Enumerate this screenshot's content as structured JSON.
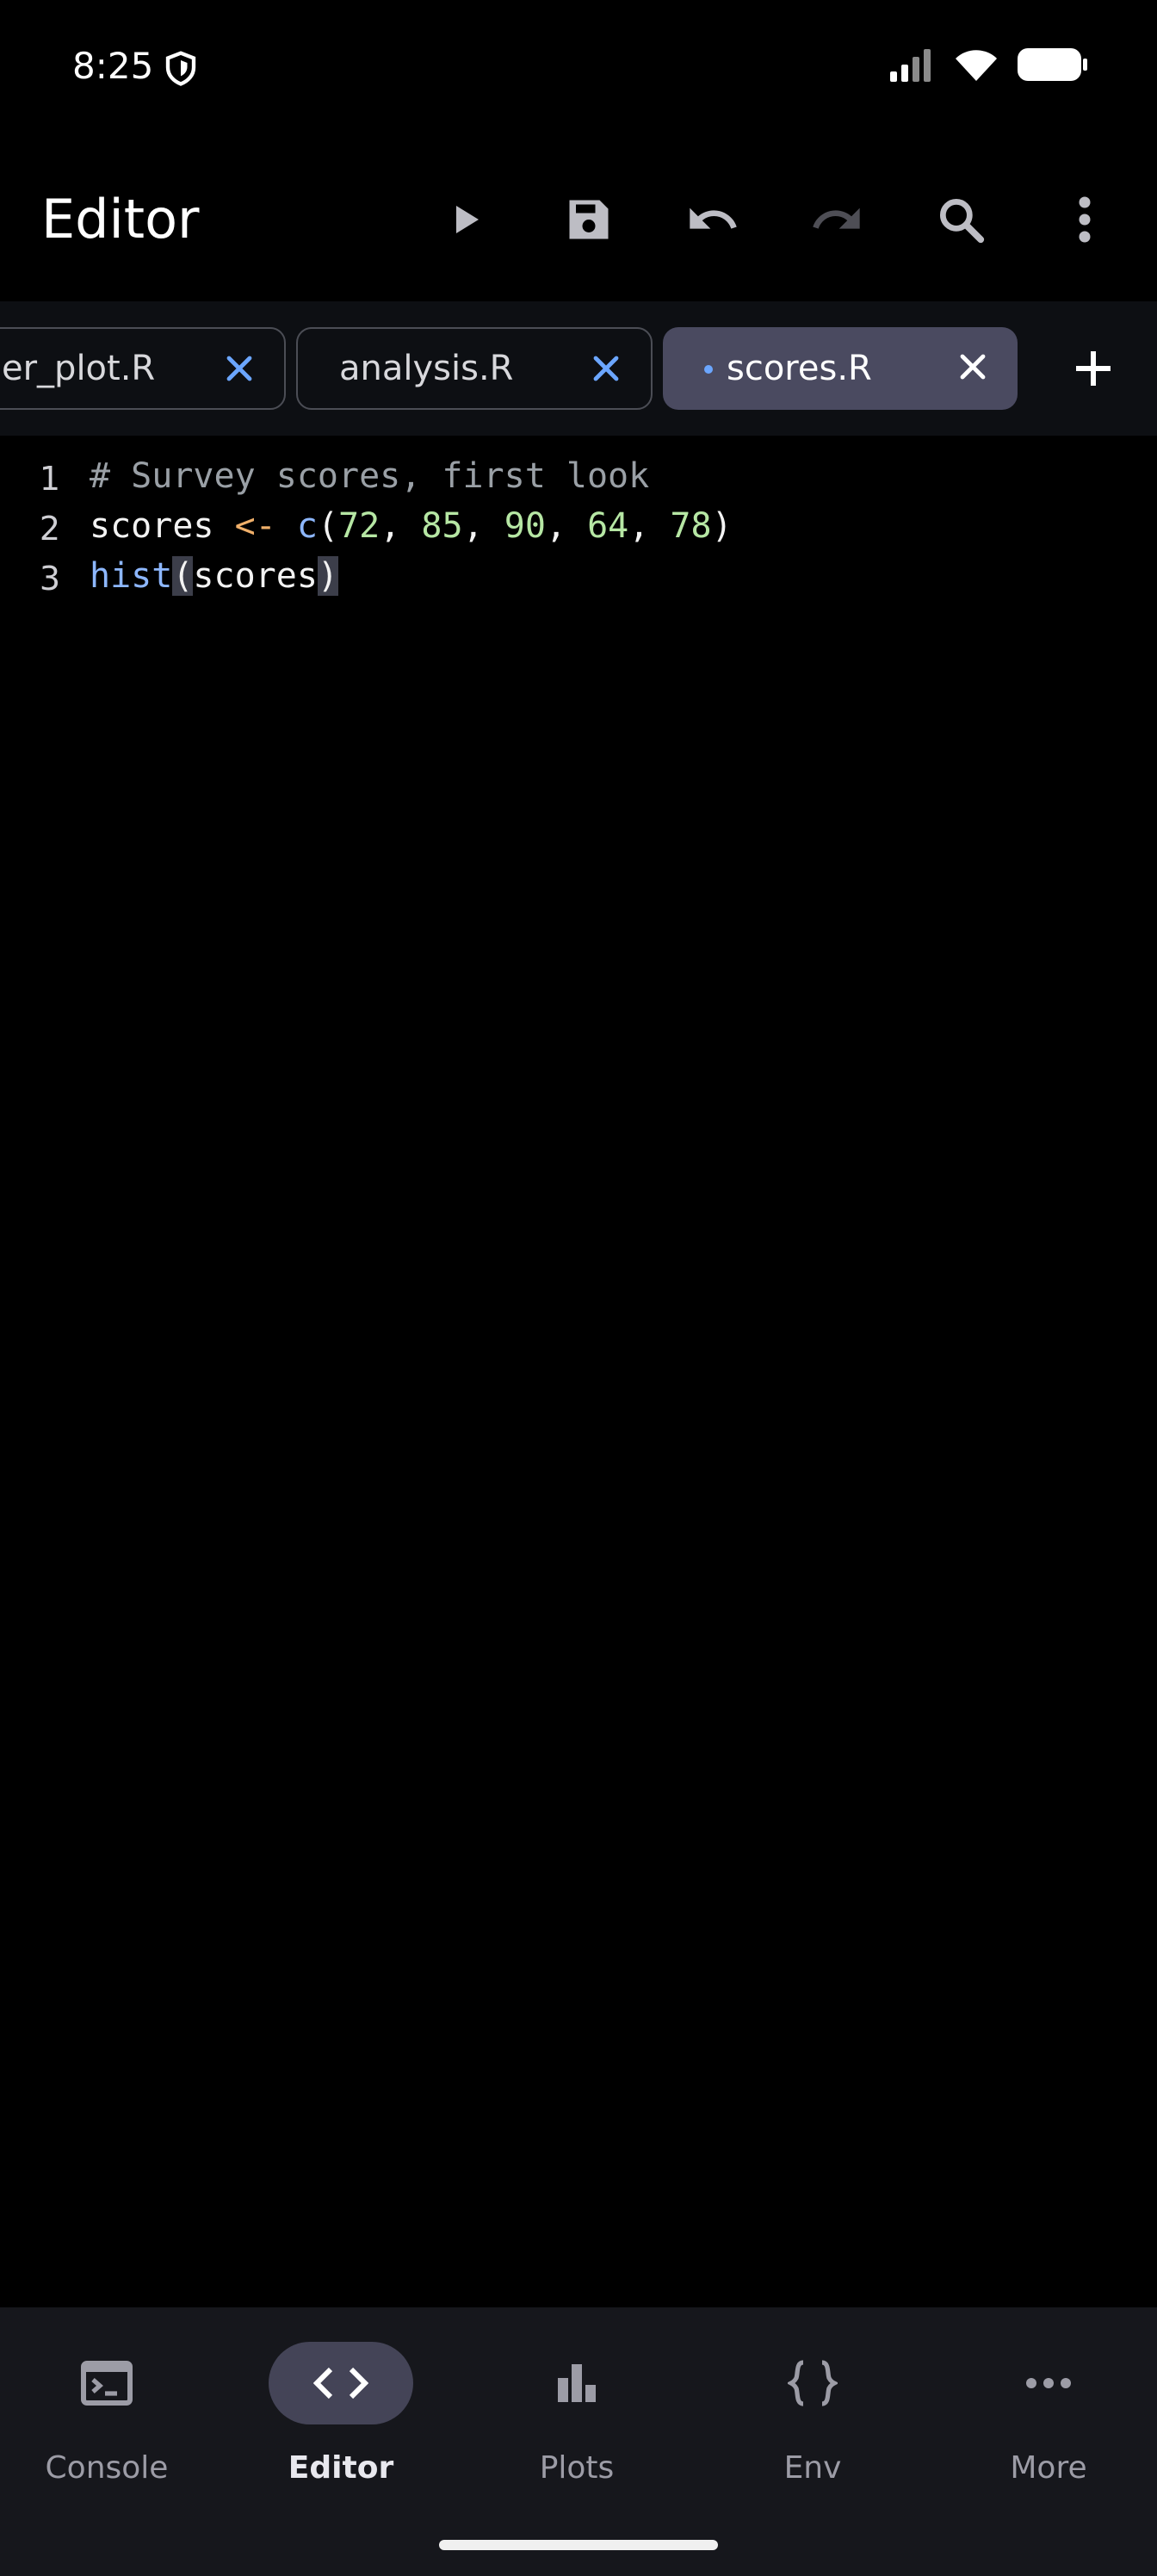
{
  "status": {
    "time": "8:25"
  },
  "appbar": {
    "title": "Editor",
    "actions": [
      {
        "name": "run",
        "icon": "play-icon"
      },
      {
        "name": "save",
        "icon": "save-icon"
      },
      {
        "name": "undo",
        "icon": "undo-icon"
      },
      {
        "name": "redo",
        "icon": "redo-icon"
      },
      {
        "name": "search",
        "icon": "search-icon"
      },
      {
        "name": "more",
        "icon": "more-vert-icon"
      }
    ]
  },
  "tabs": [
    {
      "label": "er_plot.R",
      "active": false
    },
    {
      "label": "analysis.R",
      "active": false
    },
    {
      "label": "scores.R",
      "active": true,
      "modified": true
    }
  ],
  "editor": {
    "lines": [
      {
        "number": "1",
        "comment": "# Survey scores, first look"
      },
      {
        "number": "2",
        "var": "scores",
        "op": "<-",
        "fn": "c",
        "nums": [
          "72",
          "85",
          "90",
          "64",
          "78"
        ]
      },
      {
        "number": "3",
        "fn": "hist",
        "arg": "scores"
      }
    ]
  },
  "nav": [
    {
      "label": "Console",
      "icon": "console-icon",
      "active": false
    },
    {
      "label": "Editor",
      "icon": "code-icon",
      "active": true
    },
    {
      "label": "Plots",
      "icon": "bar-chart-icon",
      "active": false
    },
    {
      "label": "Env",
      "icon": "braces-icon",
      "active": false
    },
    {
      "label": "More",
      "icon": "more-horiz-icon",
      "active": false
    }
  ],
  "colors": {
    "accent": "#6ba6ff",
    "active_tab": "#4a4a60",
    "active_nav": "#444457"
  }
}
